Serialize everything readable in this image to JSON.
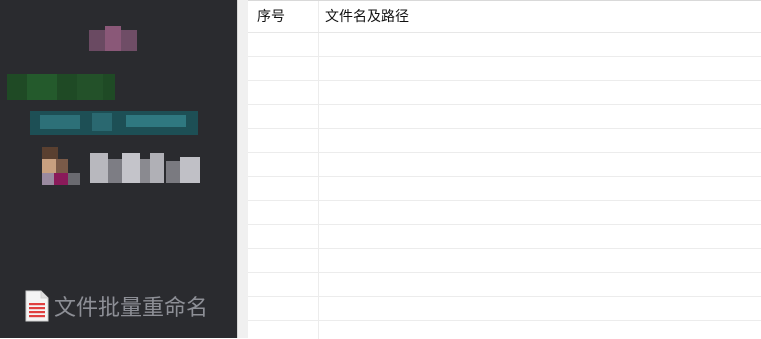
{
  "sidebar": {
    "app_title": "文件批量重命名",
    "app_icon": "document-icon"
  },
  "list": {
    "columns": [
      "序号",
      "文件名及路径"
    ],
    "rows": []
  }
}
